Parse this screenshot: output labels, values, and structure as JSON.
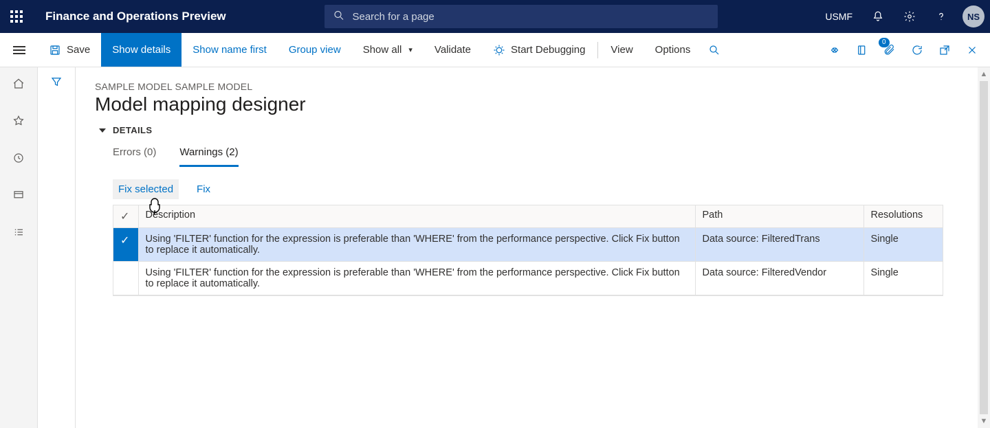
{
  "header": {
    "brand": "Finance and Operations Preview",
    "search_placeholder": "Search for a page",
    "company": "USMF",
    "avatar_initials": "NS"
  },
  "actionbar": {
    "save_label": "Save",
    "show_details_label": "Show details",
    "show_name_first_label": "Show name first",
    "group_view_label": "Group view",
    "show_all_label": "Show all",
    "validate_label": "Validate",
    "start_debugging_label": "Start Debugging",
    "view_label": "View",
    "options_label": "Options",
    "attachment_badge": "0"
  },
  "page": {
    "crumb": "SAMPLE MODEL SAMPLE MODEL",
    "title": "Model mapping designer",
    "details_section": "DETAILS"
  },
  "tabs": {
    "errors_label": "Errors (0)",
    "warnings_label": "Warnings (2)"
  },
  "fix": {
    "fix_selected_label": "Fix selected",
    "fix_label": "Fix"
  },
  "table": {
    "columns": {
      "description": "Description",
      "path": "Path",
      "resolutions": "Resolutions"
    },
    "rows": [
      {
        "selected": true,
        "description": "Using 'FILTER' function for the expression is preferable than 'WHERE' from the performance perspective. Click Fix button to replace it automatically.",
        "path": "Data source: FilteredTrans",
        "resolutions": "Single"
      },
      {
        "selected": false,
        "description": "Using 'FILTER' function for the expression is preferable than 'WHERE' from the performance perspective. Click Fix button to replace it automatically.",
        "path": "Data source: FilteredVendor",
        "resolutions": "Single"
      }
    ]
  }
}
